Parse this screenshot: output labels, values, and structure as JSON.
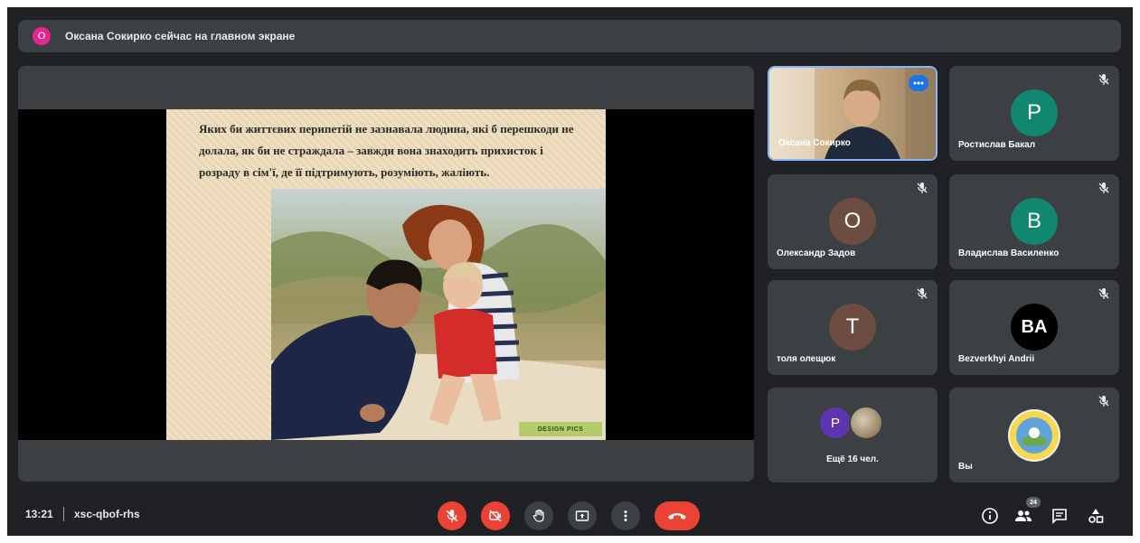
{
  "banner": {
    "avatar_letter": "О",
    "text": "Оксана Сокирко сейчас на главном экране"
  },
  "slide": {
    "text": "Яких би життєвих перипетій не зазнавала людина, які б перешкоди не долала, як би не страждала – завжди вона знаходить прихисток і розраду в сім'ї, де її підтримують, розуміють, жаліють.",
    "credit": "DESIGN PICS"
  },
  "tiles": [
    {
      "name": "Оксана Сокирко",
      "type": "video"
    },
    {
      "name": "Ростислав Бакал",
      "letter": "Р",
      "color": "#12876f"
    },
    {
      "name": "Олександр Задов",
      "letter": "О",
      "color": "#6d4c41"
    },
    {
      "name": "Владислав Василенко",
      "letter": "В",
      "color": "#12876f"
    },
    {
      "name": "толя олещюк",
      "letter": "Т",
      "color": "#6d4c41"
    },
    {
      "name": "Bezverkhyi Andrii",
      "letter": "BA",
      "color": "#000000"
    }
  ],
  "more": {
    "letter": "P",
    "label": "Ещё 16 чел."
  },
  "self": {
    "name": "Вы"
  },
  "toolbar": {
    "time": "13:21",
    "meeting_code": "xsc-qbof-rhs",
    "participants_count": "24"
  },
  "colors": {
    "background": "#202124",
    "tile": "#3c4043",
    "danger": "#ea4335",
    "accent": "#1a73e8"
  }
}
